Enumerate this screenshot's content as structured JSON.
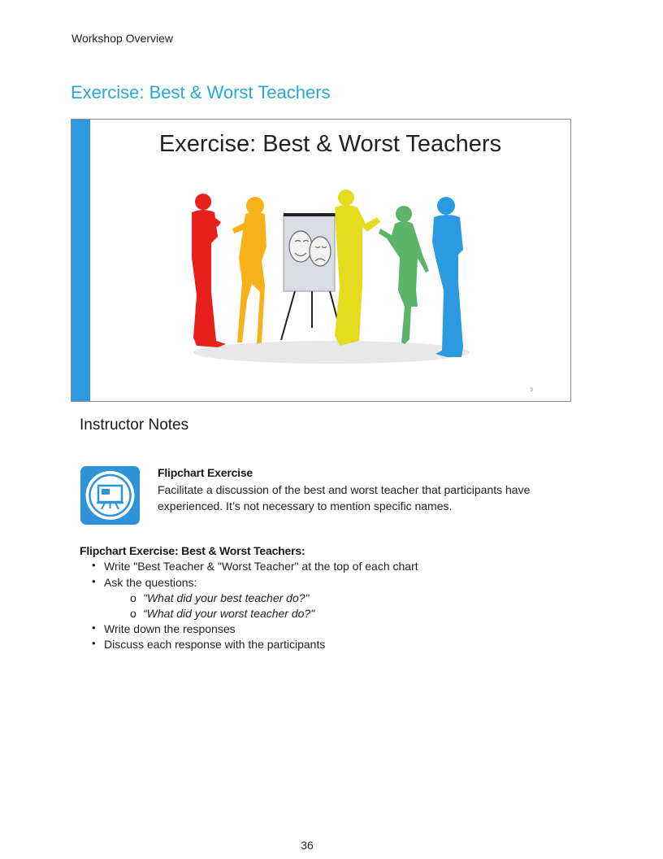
{
  "header": {
    "section": "Workshop Overview"
  },
  "title": "Exercise: Best & Worst Teachers",
  "slide": {
    "title": "Exercise: Best & Worst Teachers",
    "number": "9",
    "accent": "#2b9ae0",
    "figure_colors": [
      "#e8201c",
      "#f9b11a",
      "#e5dc1f",
      "#5cb36a",
      "#2b9ae0"
    ]
  },
  "notes_heading": "Instructor Notes",
  "flipchart": {
    "icon": "flipchart-presentation-icon",
    "title": "Flipchart Exercise",
    "text": "Facilitate a discussion of the best and worst teacher that participants have experienced. It’s not necessary to mention specific names."
  },
  "exercise": {
    "heading": "Flipchart Exercise: Best & Worst Teachers:",
    "items": [
      "Write \"Best Teacher & \"Worst Teacher\" at the top of each chart",
      "Ask the questions:",
      "Write down the responses",
      "Discuss each response with the participants"
    ],
    "sub_items": [
      "\"What did your best teacher do?\"",
      "“What did your worst teacher do?\""
    ],
    "bullet": "•",
    "sub_bullet": "o"
  },
  "page_number": "36"
}
